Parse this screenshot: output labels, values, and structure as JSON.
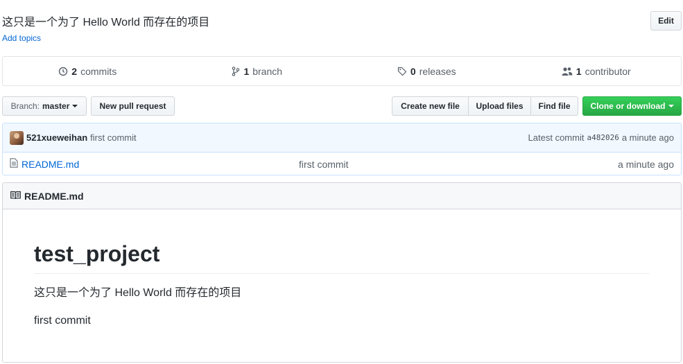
{
  "repo": {
    "description": "这只是一个为了 Hello World 而存在的项目",
    "add_topics": "Add topics",
    "edit_label": "Edit"
  },
  "numbers": {
    "commits_count": "2",
    "commits_label": "commits",
    "branch_count": "1",
    "branch_label": "branch",
    "releases_count": "0",
    "releases_label": "releases",
    "contributor_count": "1",
    "contributor_label": "contributor"
  },
  "toolbar": {
    "branch_prefix": "Branch:",
    "branch_name": "master",
    "new_pr": "New pull request",
    "create_file": "Create new file",
    "upload_files": "Upload files",
    "find_file": "Find file",
    "clone": "Clone or download"
  },
  "commit": {
    "author": "521xueweihan",
    "message": "first commit",
    "latest_label": "Latest commit",
    "sha": "a482026",
    "age": "a minute ago"
  },
  "files": [
    {
      "name": "README.md",
      "message": "first commit",
      "age": "a minute ago"
    }
  ],
  "readme": {
    "header": "README.md",
    "title": "test_project",
    "paragraphs": [
      "这只是一个为了 Hello World 而存在的项目",
      "first commit"
    ]
  },
  "colors": {
    "link": "#0366d6",
    "clone_green": "#28a745",
    "commit_bar_bg": "#f1f8ff"
  }
}
